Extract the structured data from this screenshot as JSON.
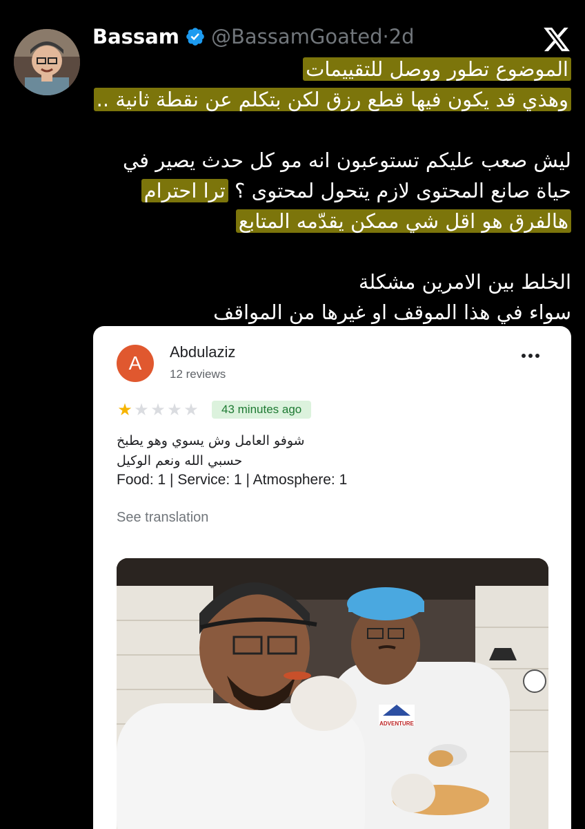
{
  "tweet": {
    "author_name": "Bassam",
    "handle": "@BassamGoated",
    "separator": "·",
    "time": "2d",
    "lines": [
      "الموضوع تطور ووصل للتقييمات",
      "وهذي قد يكون فيها قطع رزق لكن بتكلم عن نقطة ثانية ..",
      "ليش صعب عليكم تستوعبون انه مو كل حدث يصير في",
      "حياة صانع المحتوى لازم يتحول لمحتوى ؟",
      "ترا احترام",
      "هالفرق هو اقل شي ممكن يقدّمه المتابع",
      "الخلط بين الامرين مشكلة",
      "سواء في هذا الموقف او غيرها من المواقف"
    ]
  },
  "review": {
    "avatar_letter": "A",
    "reviewer_name": "Abdulaziz",
    "reviews_count": "12 reviews",
    "rating": 1,
    "rating_max": 5,
    "time_ago": "43 minutes ago",
    "text_line1": "شوفو العامل وش يسوي وهو يطبخ",
    "text_line2": "حسبي الله ونعم الوكيل",
    "ratings_summary": "Food: 1 | Service: 1 | Atmosphere: 1",
    "see_translation": "See translation",
    "apron_logo_text": "ADVENTURE"
  },
  "colors": {
    "background": "#000000",
    "highlight": "#e2d614",
    "verified": "#1d9bf0",
    "review_avatar": "#e0582f",
    "star_on": "#f6b400",
    "badge_bg": "#dcf2dd",
    "badge_text": "#1e7a33"
  },
  "icons": {
    "verified": "verified-badge-icon",
    "x_logo": "x-logo-icon",
    "more": "more-options-icon"
  }
}
